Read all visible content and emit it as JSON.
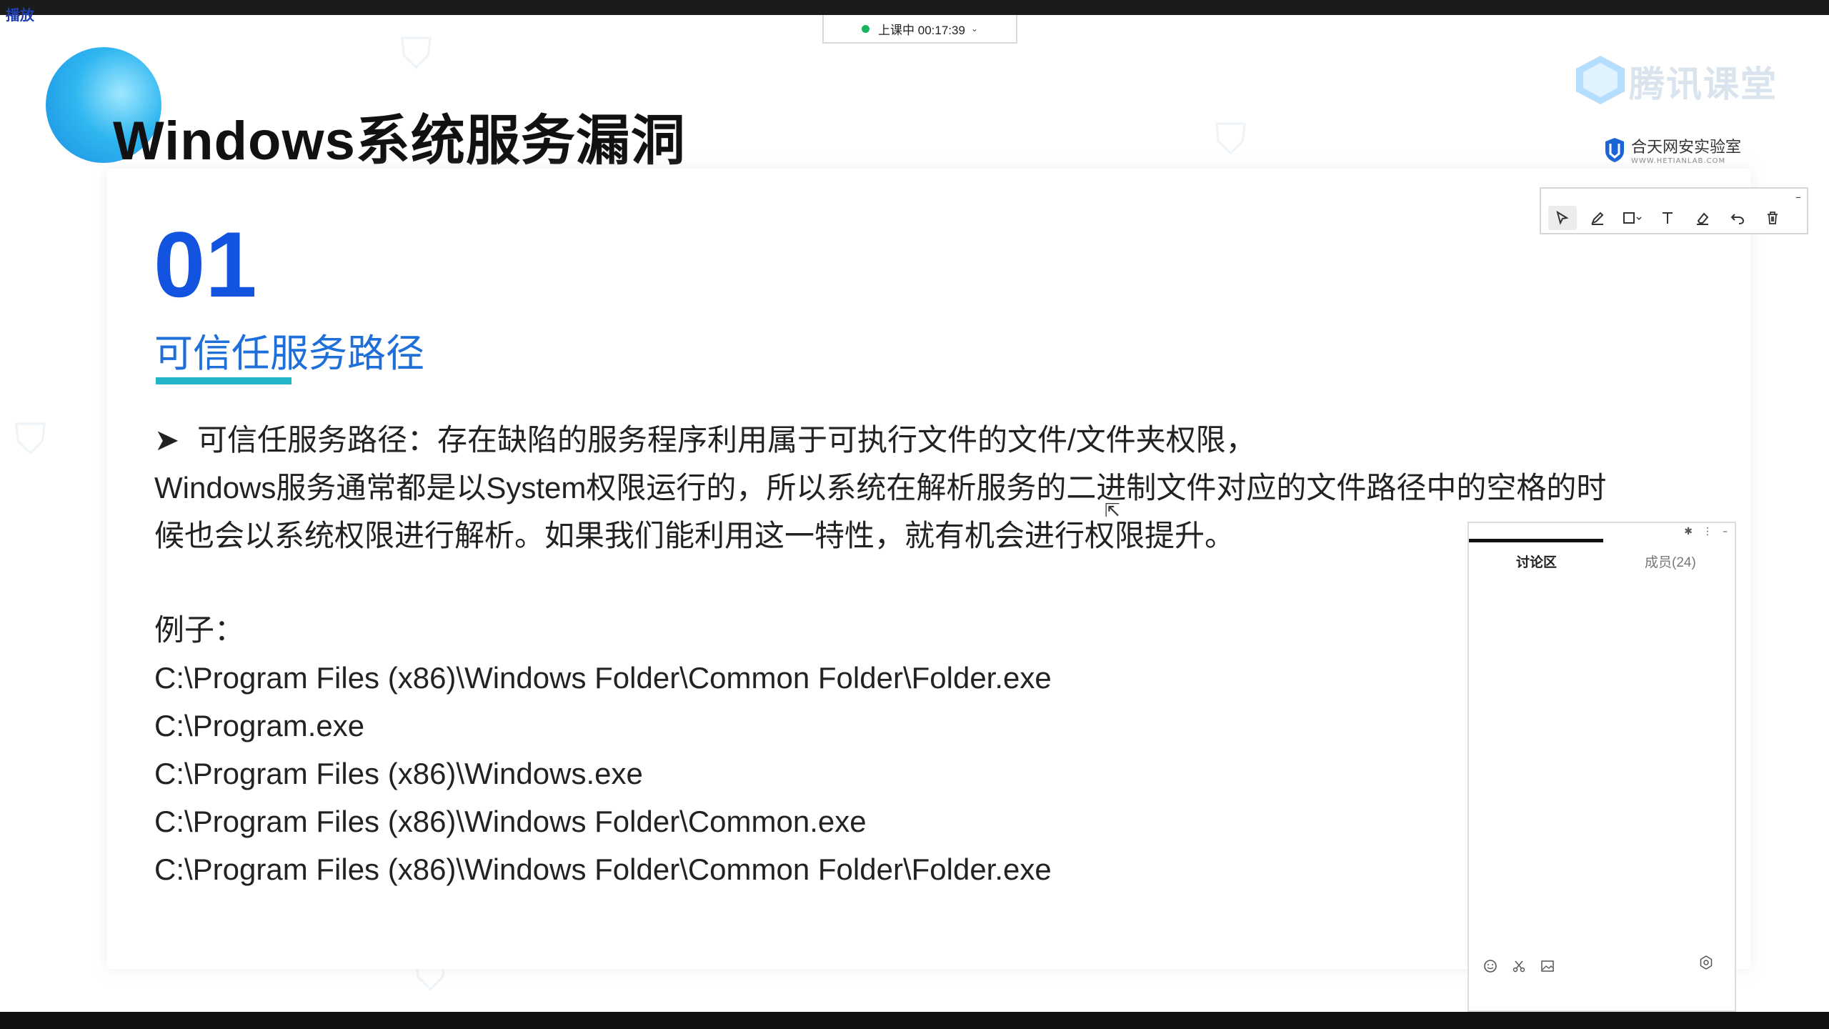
{
  "corner_label": "播放",
  "status": {
    "text": "上课中 00:17:39",
    "dot_color": "#18b35a"
  },
  "main_title": "Windows系统服务漏洞",
  "logos": {
    "ketang_text": "腾讯课堂",
    "hetian_name": "合天网安实验室",
    "hetian_sub": "WWW.HETIANLAB.COM"
  },
  "section": {
    "number": "01",
    "title": "可信任服务路径"
  },
  "body": {
    "bullet": "➤",
    "line1": "可信任服务路径：存在缺陷的服务程序利用属于可执行文件的文件/文件夹权限，",
    "line2": "Windows服务通常都是以System权限运行的，所以系统在解析服务的二进制文件对应的文件路径中的空格的时",
    "line3": "候也会以系统权限进行解析。如果我们能利用这一特性，就有机会进行权限提升。"
  },
  "examples": {
    "label": "例子：",
    "paths": [
      "C:\\Program Files (x86)\\Windows Folder\\Common Folder\\Folder.exe",
      "C:\\Program.exe",
      "C:\\Program Files (x86)\\Windows.exe",
      "C:\\Program Files (x86)\\Windows Folder\\Common.exe",
      "C:\\Program Files (x86)\\Windows Folder\\Common Folder\\Folder.exe"
    ]
  },
  "annotation_toolbar": {
    "minimize": "–",
    "tools": [
      "pointer-icon",
      "pen-icon",
      "rectangle-icon",
      "text-icon",
      "eraser-icon",
      "undo-icon",
      "trash-icon"
    ]
  },
  "discussion": {
    "tab_discuss": "讨论区",
    "tab_members": "成员(24)",
    "controls": [
      "pin-icon",
      "more-icon",
      "minimize-icon"
    ]
  },
  "colors": {
    "section_number": "#1253e0",
    "section_title": "#1e6fd9",
    "underline": "#22b6c8"
  }
}
